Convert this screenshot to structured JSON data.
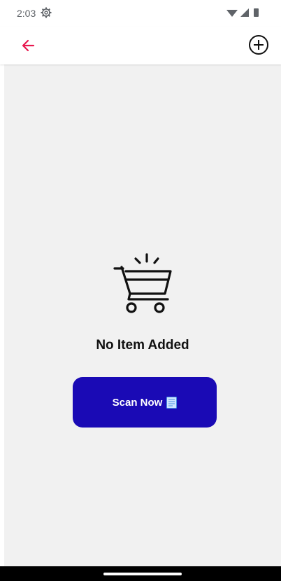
{
  "status_bar": {
    "time": "2:03",
    "settings_icon": "settings-gear-icon",
    "wifi_icon": "wifi-icon",
    "signal_icon": "cell-signal-icon",
    "battery_icon": "battery-icon"
  },
  "app_bar": {
    "back_icon": "arrow-back-icon",
    "back_color": "#e8194f",
    "add_icon": "add-circle-icon"
  },
  "empty_state": {
    "icon": "shopping-cart-icon",
    "title": "No Item Added"
  },
  "scan_button": {
    "label": "Scan Now",
    "icon": "receipt-icon",
    "background": "#1a0ab5"
  },
  "colors": {
    "content_background": "#f1f1f1",
    "nav_bar": "#000000"
  }
}
